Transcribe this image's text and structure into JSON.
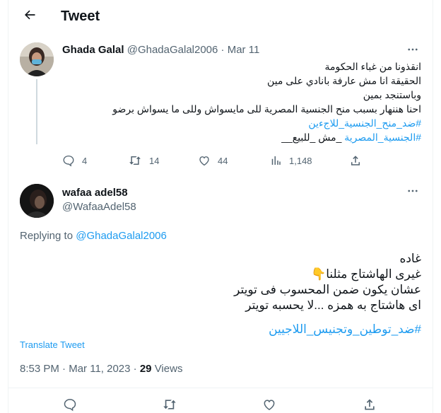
{
  "header": {
    "title": "Tweet"
  },
  "original": {
    "name": "Ghada Galal",
    "handle": "@GhadaGalal2006",
    "sep": "·",
    "date": "Mar 11",
    "lines": [
      "انقذونا من غباء الحكومة",
      "الحقيقة انا مش عارفة بانادي على مين",
      "وباستنجد بمين",
      "احنا هننهار بسبب منح الجنسية المصرية للى مايسواش وللى ما يسواش برضو"
    ],
    "hashtag1": "#ضد_منح_الجنسية_للاجءين",
    "hashtag2": "#الجنسية_المصرية",
    "hashtag2_tail": " _مش _للبيع__",
    "stats": {
      "replies": "4",
      "retweets": "14",
      "likes": "44",
      "views": "1,148"
    }
  },
  "reply": {
    "name": "wafaa adel58",
    "handle": "@WafaaAdel58",
    "replying_prefix": "Replying to ",
    "replying_to": "@GhadaGalal2006",
    "lines": [
      "غاده",
      "غيرى الهاشتاج مثلنا👇",
      "عشان يكون ضمن المحسوب فى تويتر",
      "اى هاشتاج به همزه ...لا يحسبه تويتر"
    ],
    "hashtag": "#ضد_توطين_وتجنيس_اللاجيين",
    "translate": "Translate Tweet",
    "time": "8:53 PM",
    "sep": "·",
    "date": "Mar 11, 2023",
    "sep2": "·",
    "views_count": "29",
    "views_label": " Views"
  },
  "colors": {
    "accent": "#1d9bf0",
    "muted": "#536471",
    "border": "#eff3f4"
  },
  "icons": [
    "back-arrow-icon",
    "more-icon",
    "reply-icon",
    "retweet-icon",
    "like-icon",
    "views-icon",
    "share-icon"
  ]
}
